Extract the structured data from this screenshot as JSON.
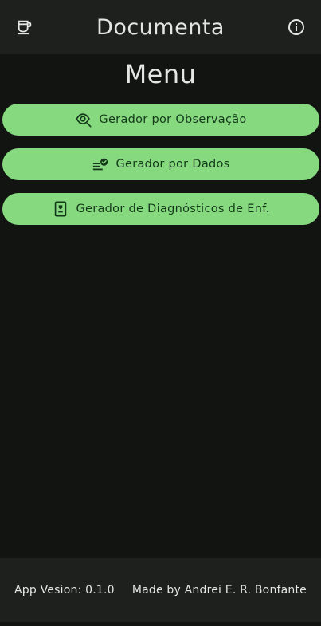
{
  "appbar": {
    "title": "Documenta",
    "left_icon": "mug-icon",
    "right_icon": "info-icon"
  },
  "menu": {
    "title": "Menu",
    "buttons": [
      {
        "label": "Gerador por Observação",
        "icon": "eye-search-icon"
      },
      {
        "label": "Gerador por Dados",
        "icon": "checklist-icon"
      },
      {
        "label": "Gerador de Diagnósticos de Enf.",
        "icon": "id-badge-icon"
      }
    ]
  },
  "footer": {
    "version": "App Vesion: 0.1.0",
    "author": "Made by Andrei E. R. Bonfante"
  },
  "colors": {
    "background": "#121412",
    "bar": "#1d201d",
    "button": "#86d97f",
    "button_text": "#14391a",
    "text": "#e3e6e1"
  }
}
